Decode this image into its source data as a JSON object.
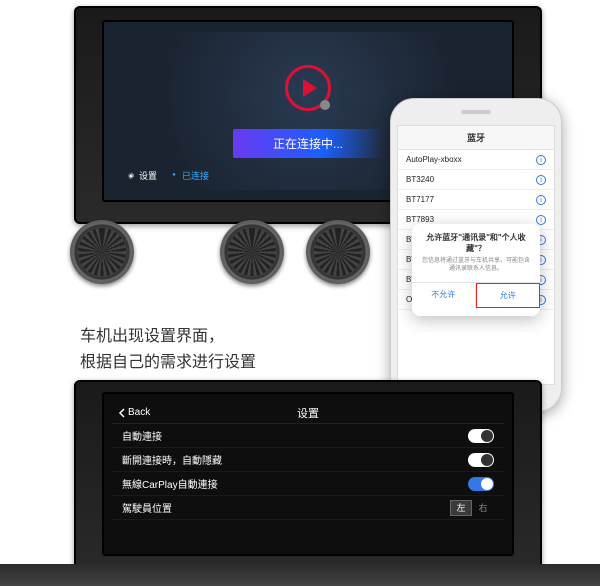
{
  "screen1": {
    "status_text": "正在连接中...",
    "bottom": {
      "settings": "设置",
      "connected": "已连接"
    }
  },
  "phone": {
    "header_title": "蓝牙",
    "rows": [
      {
        "label": "AutoPlay-xboxx"
      },
      {
        "label": "BT3240"
      },
      {
        "label": "BT7177"
      },
      {
        "label": "BT7893"
      },
      {
        "label": "BT3968"
      },
      {
        "label": "BT6883"
      },
      {
        "label": "BT7639"
      },
      {
        "label": "OPPO R7s"
      }
    ],
    "popup": {
      "title": "允许蓝牙\"通讯录\"和\"个人收藏\"？",
      "body": "您信息将通过蓝牙与车机共享。可能包含通讯录联系人信息。",
      "deny": "不允许",
      "allow": "允许"
    }
  },
  "caption": {
    "line1": "车机出现设置界面，",
    "line2": "根据自己的需求进行设置"
  },
  "screen2": {
    "back": "Back",
    "title": "设置",
    "rows": {
      "auto_connect": "自動連接",
      "auto_hide": "斷開連接時，自動隱藏",
      "carplay_auto": "無線CarPlay自動連接",
      "driver_pos": "駕駛員位置",
      "left": "左",
      "right": "右"
    }
  }
}
